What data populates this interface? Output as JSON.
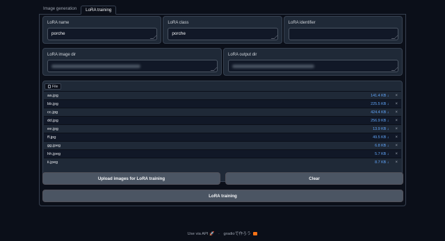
{
  "tabs": [
    {
      "label": "Image generation",
      "active": false
    },
    {
      "label": "LoRA training",
      "active": true
    }
  ],
  "fields_row1": {
    "lora_name": {
      "label": "LoRA name",
      "value": "porche"
    },
    "lora_class": {
      "label": "LoRA class",
      "value": "porche"
    },
    "lora_identifier": {
      "label": "LoRA identifier",
      "value": ""
    }
  },
  "fields_row2": {
    "image_dir": {
      "label": "LoRA image dir"
    },
    "output_dir": {
      "label": "LoRA output dir"
    }
  },
  "file_panel": {
    "tag_label": "File",
    "files": [
      {
        "name": "aa.jpg",
        "size": "141.4 KB ↓"
      },
      {
        "name": "bb.jpg",
        "size": "225.5 KB ↓"
      },
      {
        "name": "cc.jpg",
        "size": "424.4 KB ↓"
      },
      {
        "name": "dd.jpg",
        "size": "256.9 KB ↓"
      },
      {
        "name": "ee.jpg",
        "size": "13.9 KB ↓"
      },
      {
        "name": "ff.jpg",
        "size": "49.5 KB ↓"
      },
      {
        "name": "gg.jpeg",
        "size": "6.8 KB ↓"
      },
      {
        "name": "hh.jpeg",
        "size": "5.7 KB ↓"
      },
      {
        "name": "ii.jpeg",
        "size": "8.7 KB ↓"
      }
    ],
    "remove_glyph": "×"
  },
  "buttons": {
    "upload": "Upload images for LoRA training",
    "clear": "Clear",
    "train": "LoRA training"
  },
  "footer": {
    "api_text": "Use via API",
    "separator": "·",
    "built_with": "gradioで作ろう"
  },
  "colors": {
    "background": "#0b0f19",
    "panel": "#1f2937",
    "button": "#4b5563",
    "file_size": "#60a5fa"
  }
}
